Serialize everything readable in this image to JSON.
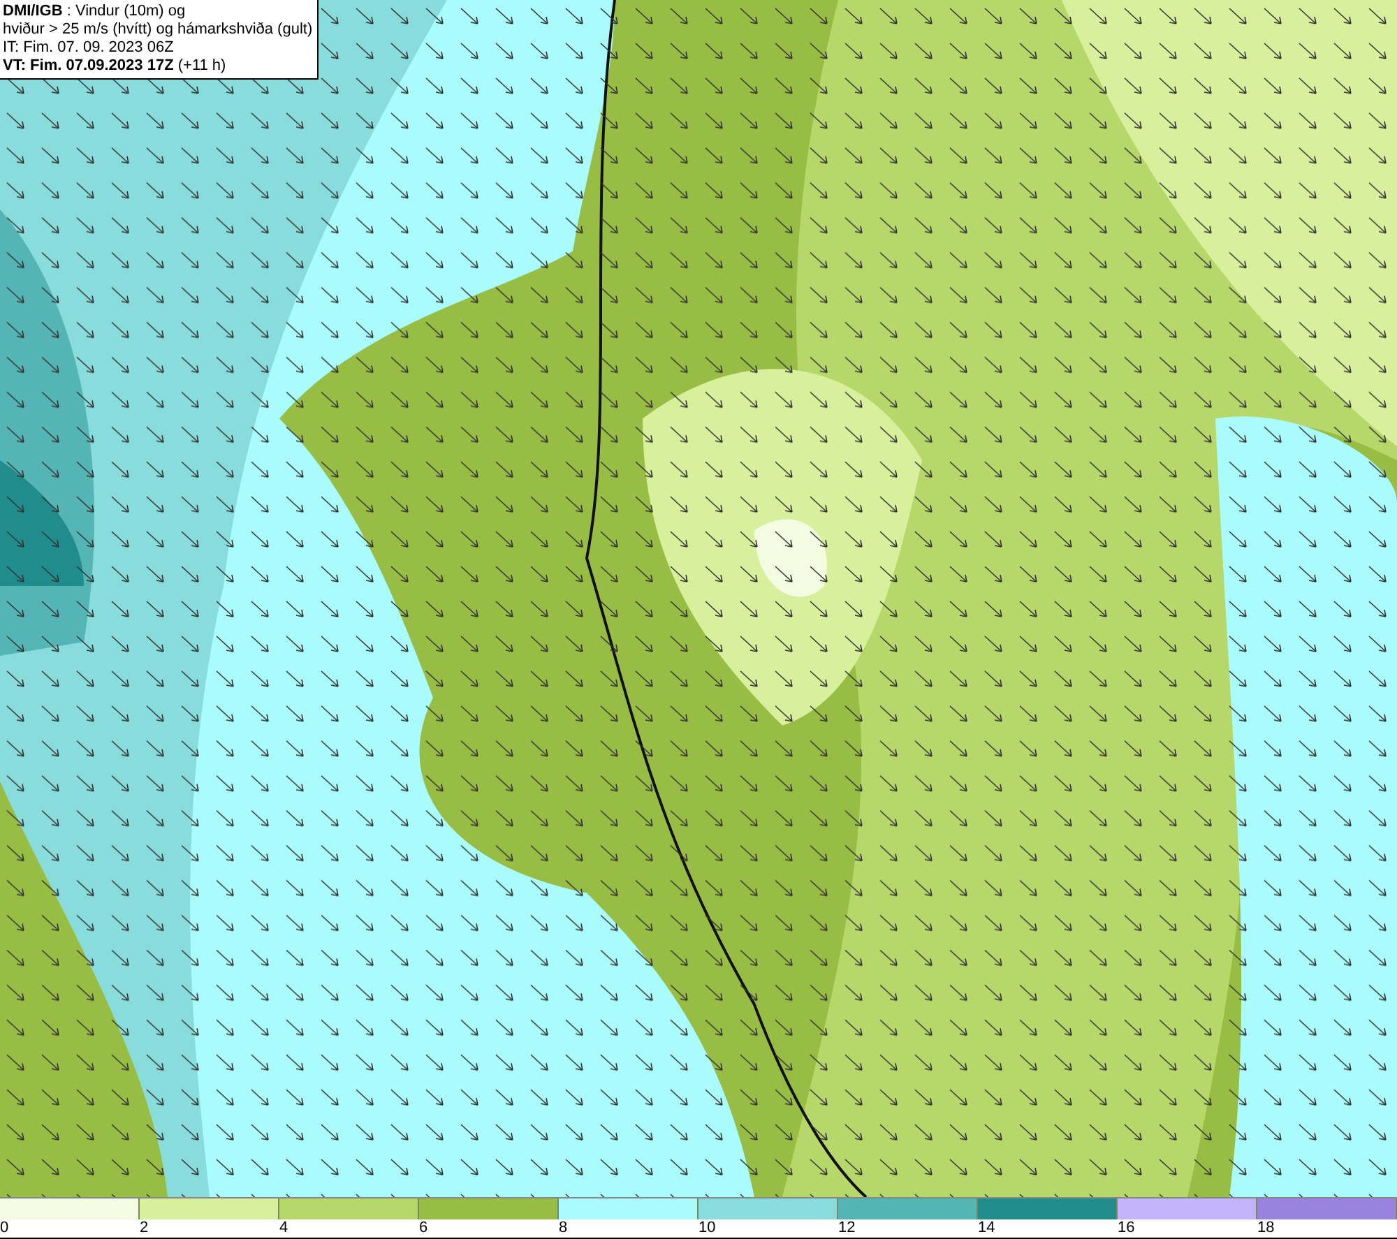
{
  "header": {
    "lines": [
      "**DMI/IGB** : Vindur (10m) og",
      "hviður > 25 m/s (hvítt) og hámarkshviða (gult)",
      "IT: Fim. 07. 09. 2023 06Z",
      "**VT: Fim. 07.09.2023 17Z** (+11 h)"
    ]
  },
  "legend": [
    {
      "label": "0",
      "color": "#f3fbe0"
    },
    {
      "label": "2",
      "color": "#d8ef9c"
    },
    {
      "label": "4",
      "color": "#b6d86b"
    },
    {
      "label": "6",
      "color": "#98bd45"
    },
    {
      "label": "8",
      "color": "#aafbfb"
    },
    {
      "label": "10",
      "color": "#88dcdc"
    },
    {
      "label": "12",
      "color": "#55b4b4"
    },
    {
      "label": "14",
      "color": "#208c8c"
    },
    {
      "label": "16",
      "color": "#c3b4fb"
    },
    {
      "label": "18",
      "color": "#9a82e0"
    }
  ]
}
